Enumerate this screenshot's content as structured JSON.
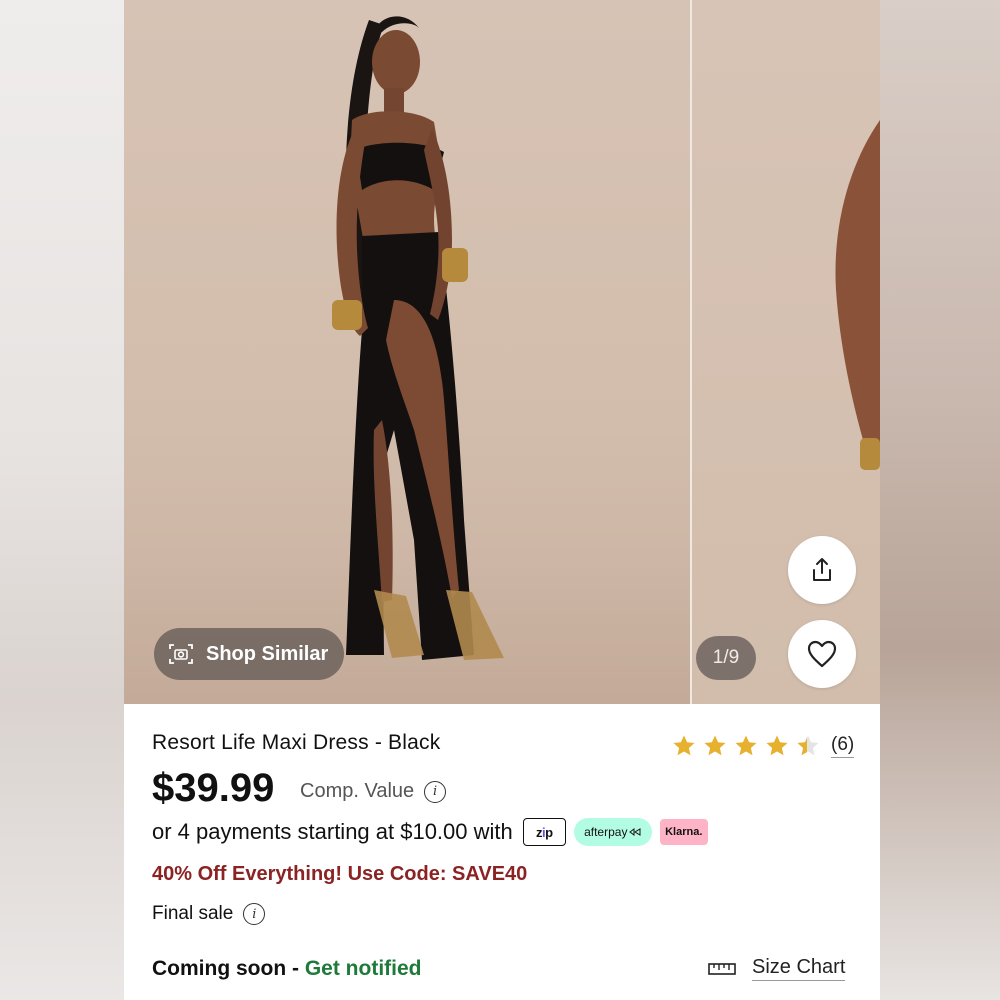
{
  "gallery": {
    "shop_similar_label": "Shop Similar",
    "counter": "1/9"
  },
  "product": {
    "title": "Resort Life Maxi Dress - Black",
    "rating": 4.5,
    "rating_count": "(6)",
    "price": "$39.99",
    "comp_value_label": "Comp. Value",
    "payments_text": "or 4 payments starting at $10.00 with",
    "payment_providers": {
      "zip": "zip",
      "afterpay": "afterpay",
      "klarna": "Klarna."
    },
    "promo": "40% Off Everything! Use Code: SAVE40",
    "final_sale": "Final sale",
    "coming_soon": "Coming soon - ",
    "get_notified": "Get notified",
    "size_chart": "Size Chart"
  },
  "colors": {
    "promo": "#8b2323",
    "notify": "#1f7a3a",
    "star": "#e6b12e",
    "afterpay": "#b2fce4",
    "klarna": "#ffb3c7"
  },
  "icons": {
    "shop_similar": "camera-scan-icon",
    "share": "share-icon",
    "wishlist": "heart-icon",
    "info": "info-icon",
    "size_chart": "ruler-icon"
  }
}
